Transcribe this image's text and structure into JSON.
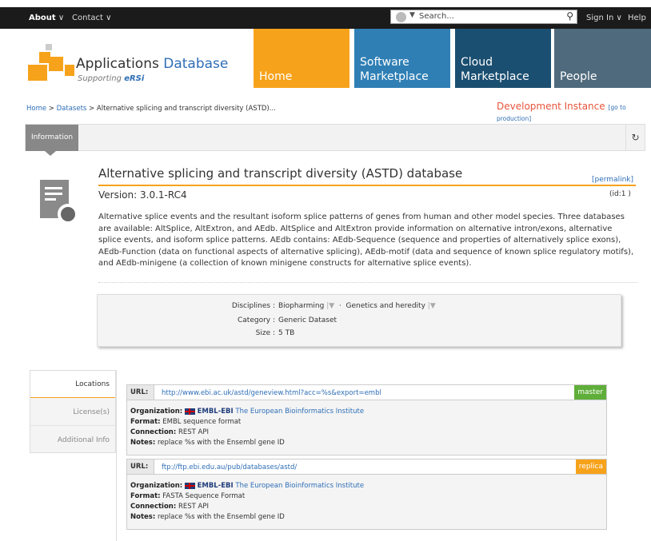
{
  "topnav": {
    "about": "About",
    "contact": "Contact",
    "search_placeholder": "Search...",
    "sign_in": "Sign In",
    "help": "Help"
  },
  "brand": {
    "name_part1": "Applications",
    "name_part2": "Database",
    "sub": "Supporting",
    "ebi": "eRSi"
  },
  "tiles": [
    {
      "label": "Home",
      "color": "#f7a21b"
    },
    {
      "label": "Software Marketplace",
      "color": "#2f7fb5"
    },
    {
      "label": "Cloud Marketplace",
      "color": "#1b4f71"
    },
    {
      "label": "People",
      "color": "#4f6a7c"
    }
  ],
  "breadcrumb": {
    "home": "Home",
    "datasets": "Datasets",
    "current": "Alternative splicing and transcript diversity (ASTD)..."
  },
  "dev": {
    "label": "Development Instance",
    "link": "[go to production]"
  },
  "tabs": {
    "information": "Information",
    "refresh_icon": "↻"
  },
  "dataset": {
    "title": "Alternative splicing and transcript diversity (ASTD) database",
    "permalink": "[permalink]",
    "version_label": "Version:",
    "version": "3.0.1-RC4",
    "id": "(id:1 )",
    "description": "Alternative splice events and the resultant isoform splice patterns of genes from human and other model species. Three databases are available: AltSplice, AltExtron, and AEdb. AltSplice and AltExtron provide information on alternative intron/exons, alternative splice events, and isoform splice patterns. AEdb contains: AEdb-Sequence (sequence and properties of alternatively splice exons), AEdb-Function (data on functional aspects of alternative splicing), AEdb-motif (data and sequence of known splice regulatory motifs), and AEdb-minigene (a collection of known minigene constructs for alternative splice events)."
  },
  "meta": {
    "disciplines_label": "Disciplines :",
    "discipline1": "Biopharming",
    "discipline2": "Genetics and heredity",
    "category_label": "Category :",
    "category": "Generic Dataset",
    "size_label": "Size :",
    "size": "5 TB"
  },
  "side_tabs": [
    "Locations",
    "License(s)",
    "Additional Info"
  ],
  "locations": [
    {
      "url_label": "URL:",
      "url": "http://www.ebi.ac.uk/astd/geneview.html?acc=%s&export=embl",
      "badge": "master",
      "badge_color": "#5fae3a",
      "org_label": "Organization:",
      "org_short": "EMBL-EBI",
      "org_name": "The European Bioinformatics Institute",
      "format_label": "Format:",
      "format": "EMBL sequence format",
      "connection_label": "Connection:",
      "connection": "REST API",
      "notes_label": "Notes:",
      "notes": "replace %s with the Ensembl gene ID"
    },
    {
      "url_label": "URL:",
      "url": "ftp://ftp.ebi.edu.au/pub/databases/astd/",
      "badge": "replica",
      "badge_color": "#f7a21b",
      "org_label": "Organization:",
      "org_short": "EMBL-EBI",
      "org_name": "The European Bioinformatics Institute",
      "format_label": "Format:",
      "format": "FASTA Sequence Format",
      "connection_label": "Connection:",
      "connection": "REST API",
      "notes_label": "Notes:",
      "notes": "replace %s with the Ensembl gene ID"
    }
  ]
}
